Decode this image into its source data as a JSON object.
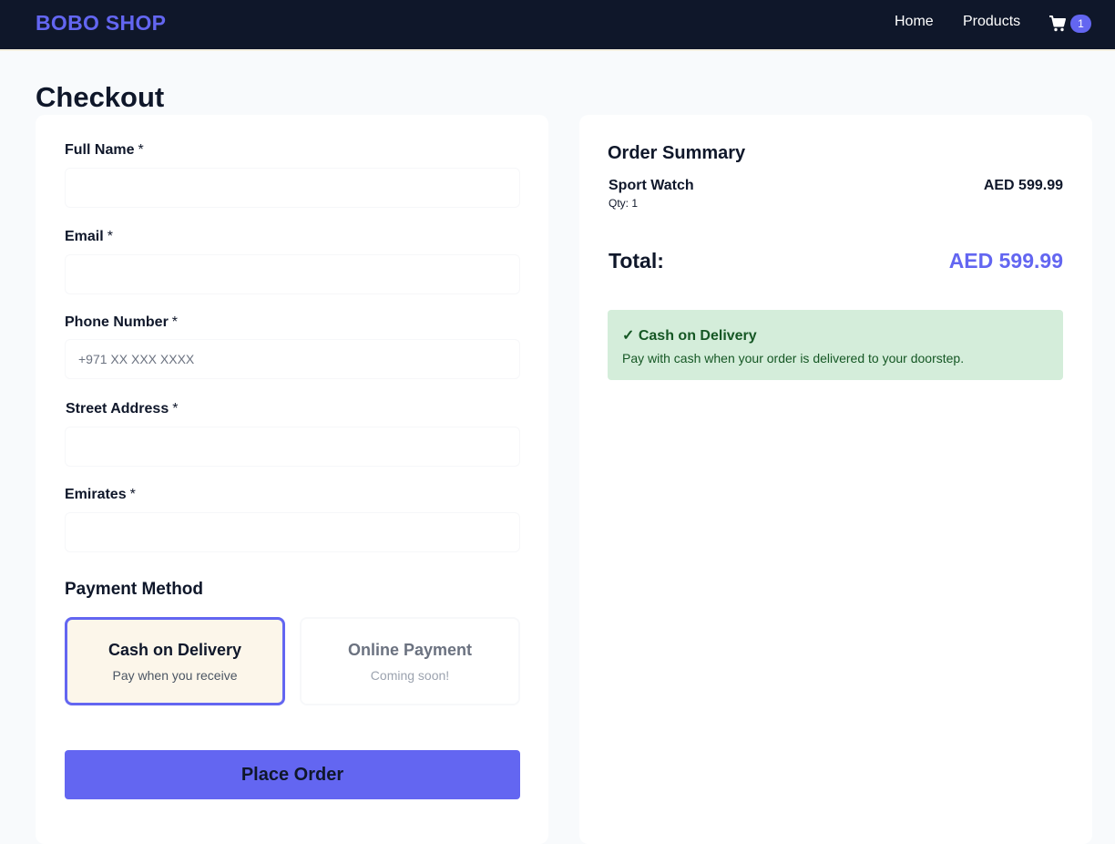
{
  "navbar": {
    "brand": "BOBO SHOP",
    "links": [
      {
        "label": "Home"
      },
      {
        "label": "Products"
      }
    ],
    "cart": {
      "icon": "shopping-cart-icon",
      "count": "1"
    }
  },
  "page_title": "Checkout",
  "form": {
    "fields": [
      {
        "label": "Full Name",
        "required_mark": "*",
        "value": "",
        "placeholder": ""
      },
      {
        "label": "Email",
        "required_mark": "*",
        "value": "",
        "placeholder": ""
      },
      {
        "label": "Phone Number",
        "required_mark": "*",
        "value": "",
        "placeholder": "+971 XX XXX XXXX"
      },
      {
        "label": "Street Address",
        "required_mark": "*",
        "value": "",
        "placeholder": ""
      },
      {
        "label": "Emirates",
        "required_mark": "*",
        "value": "",
        "placeholder": ""
      }
    ],
    "payment": {
      "title": "Payment Method",
      "options": [
        {
          "name": "Cash on Delivery",
          "sub": "Pay when you receive",
          "selected": true
        },
        {
          "name": "Online Payment",
          "sub": "Coming soon!",
          "selected": false
        }
      ]
    },
    "submit_label": "Place Order"
  },
  "summary": {
    "title": "Order Summary",
    "items": [
      {
        "name": "Sport Watch",
        "qty": "Qty: 1",
        "price": "AED 599.99"
      }
    ],
    "total_label": "Total:",
    "total_value": "AED 599.99",
    "notice": {
      "title": "✓ Cash on Delivery",
      "text": "Pay with cash when your order is delivered to your doorstep."
    }
  },
  "colors": {
    "navbar_bg": "#0f172a",
    "accent": "#6366f1",
    "notice_bg": "#d4edda",
    "notice_text": "#155724",
    "selected_option_bg": "#fcf6ea"
  }
}
